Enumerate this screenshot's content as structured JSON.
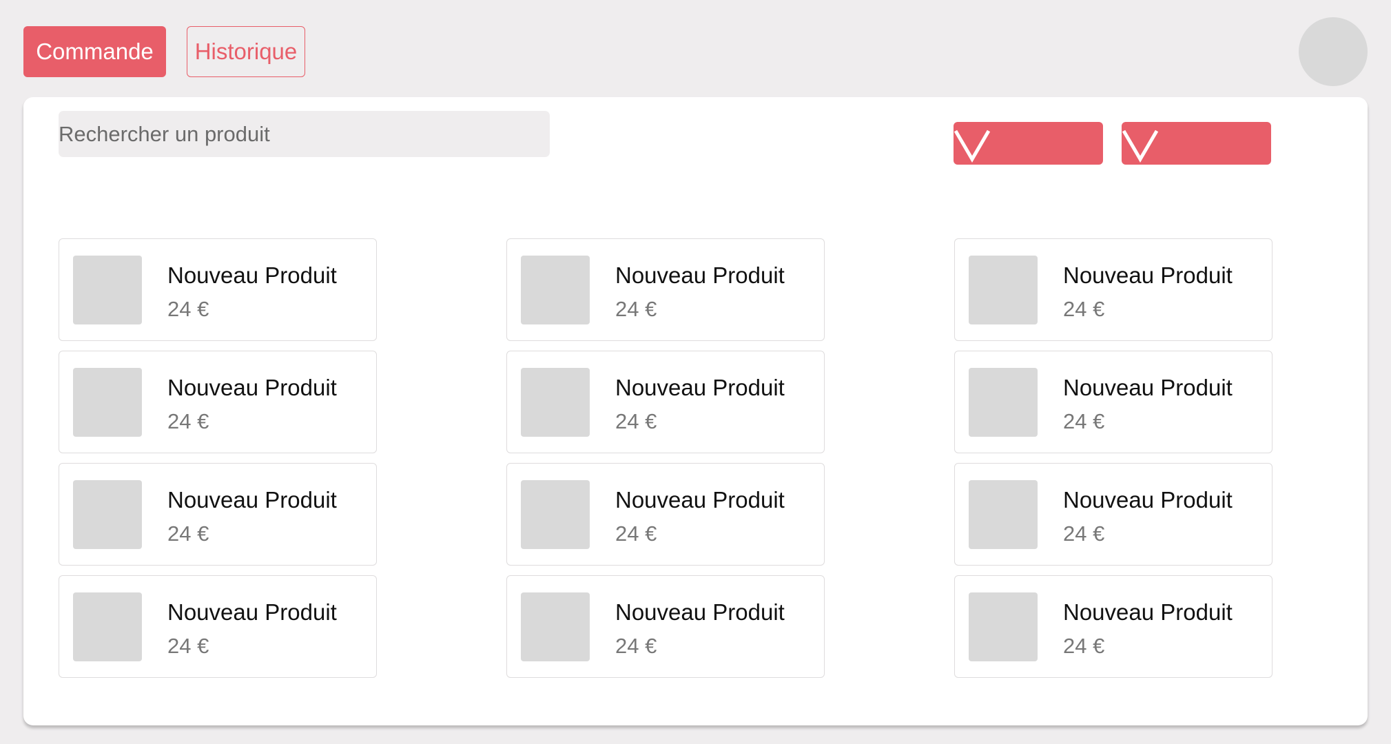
{
  "header": {
    "tab_commande": "Commande",
    "tab_historique": "Historique"
  },
  "search": {
    "placeholder": "Rechercher un produit"
  },
  "filters": {
    "icon": "chevron-down-icon"
  },
  "colors": {
    "accent": "#e85e69",
    "background": "#efedee",
    "placeholder_gray": "#d9d9d9"
  },
  "products": [
    {
      "name": "Nouveau Produit",
      "price": "24 €"
    },
    {
      "name": "Nouveau Produit",
      "price": "24 €"
    },
    {
      "name": "Nouveau Produit",
      "price": "24 €"
    },
    {
      "name": "Nouveau Produit",
      "price": "24 €"
    },
    {
      "name": "Nouveau Produit",
      "price": "24 €"
    },
    {
      "name": "Nouveau Produit",
      "price": "24 €"
    },
    {
      "name": "Nouveau Produit",
      "price": "24 €"
    },
    {
      "name": "Nouveau Produit",
      "price": "24 €"
    },
    {
      "name": "Nouveau Produit",
      "price": "24 €"
    },
    {
      "name": "Nouveau Produit",
      "price": "24 €"
    },
    {
      "name": "Nouveau Produit",
      "price": "24 €"
    },
    {
      "name": "Nouveau Produit",
      "price": "24 €"
    }
  ]
}
